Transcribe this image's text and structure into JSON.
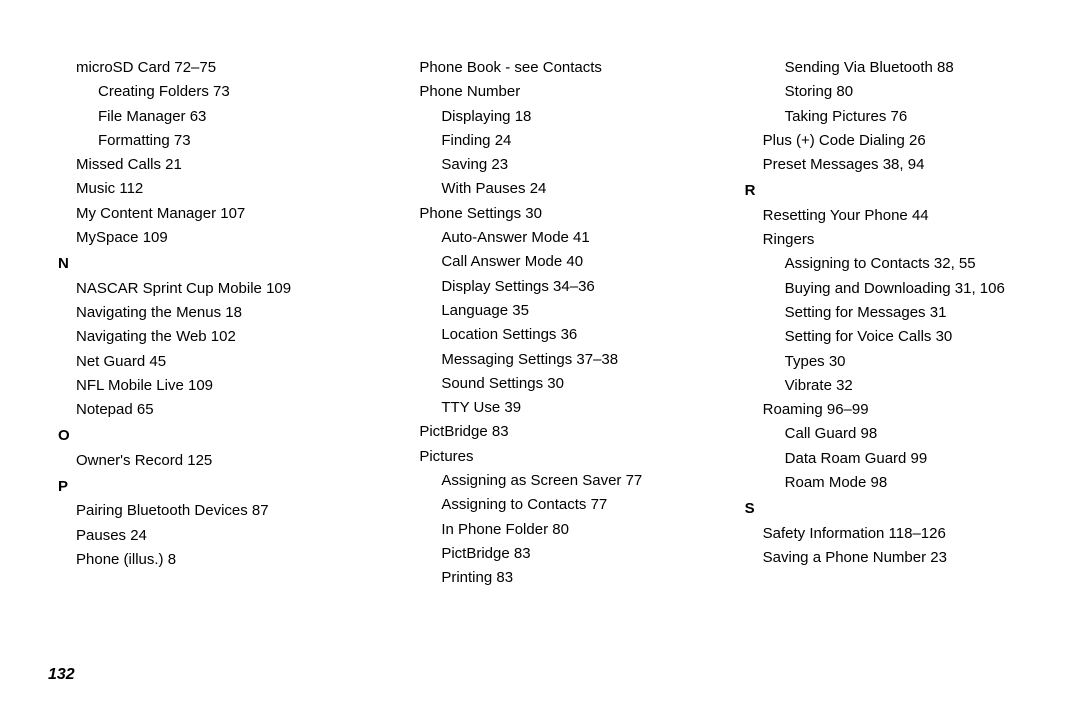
{
  "page_number": "132",
  "col1": {
    "microsd": "microSD Card 72–75",
    "creating_folders": "Creating Folders 73",
    "file_manager": "File Manager 63",
    "formatting": "Formatting 73",
    "missed_calls": "Missed Calls 21",
    "music": "Music 112",
    "my_content": "My Content Manager 107",
    "myspace": "MySpace 109",
    "letter_n": "N",
    "nascar": "NASCAR Sprint Cup Mobile 109",
    "nav_menus": "Navigating the Menus 18",
    "nav_web": "Navigating the Web 102",
    "net_guard": "Net Guard 45",
    "nfl": "NFL Mobile Live 109",
    "notepad": "Notepad 65",
    "letter_o": "O",
    "owners": "Owner's Record 125",
    "letter_p": "P",
    "pairing": "Pairing Bluetooth Devices 87",
    "pauses": "Pauses 24",
    "phone_illus": "Phone (illus.) 8"
  },
  "col2": {
    "phone_book": "Phone Book - see Contacts",
    "phone_number": "Phone Number",
    "displaying": "Displaying 18",
    "finding": "Finding 24",
    "saving": "Saving 23",
    "with_pauses": "With Pauses 24",
    "phone_settings": "Phone Settings 30",
    "auto_answer": "Auto-Answer Mode 41",
    "call_answer": "Call Answer Mode 40",
    "display_settings": "Display Settings 34–36",
    "language": "Language 35",
    "location": "Location Settings 36",
    "messaging": "Messaging Settings 37–38",
    "sound": "Sound Settings 30",
    "tty": "TTY Use 39",
    "pictbridge": "PictBridge 83",
    "pictures": "Pictures",
    "screen_saver": "Assigning as Screen Saver 77",
    "assign_contacts": "Assigning to Contacts 77",
    "in_phone": "In Phone Folder 80",
    "pictbridge2": "PictBridge 83",
    "printing": "Printing 83"
  },
  "col3": {
    "sending_bt": "Sending Via Bluetooth 88",
    "storing": "Storing 80",
    "taking": "Taking Pictures 76",
    "plus_code": "Plus (+) Code Dialing 26",
    "preset": "Preset Messages 38, 94",
    "letter_r": "R",
    "resetting": "Resetting Your Phone 44",
    "ringers": "Ringers",
    "r_assign": "Assigning to Contacts 32, 55",
    "r_buying": "Buying and Downloading 31, 106",
    "r_messages": "Setting for Messages 31",
    "r_voice": "Setting for Voice Calls 30",
    "r_types": "Types 30",
    "r_vibrate": "Vibrate 32",
    "roaming": "Roaming 96–99",
    "call_guard": "Call Guard 98",
    "data_roam": "Data Roam Guard 99",
    "roam_mode": "Roam Mode 98",
    "letter_s": "S",
    "safety": "Safety Information 118–126",
    "saving_num": "Saving a Phone Number 23"
  }
}
